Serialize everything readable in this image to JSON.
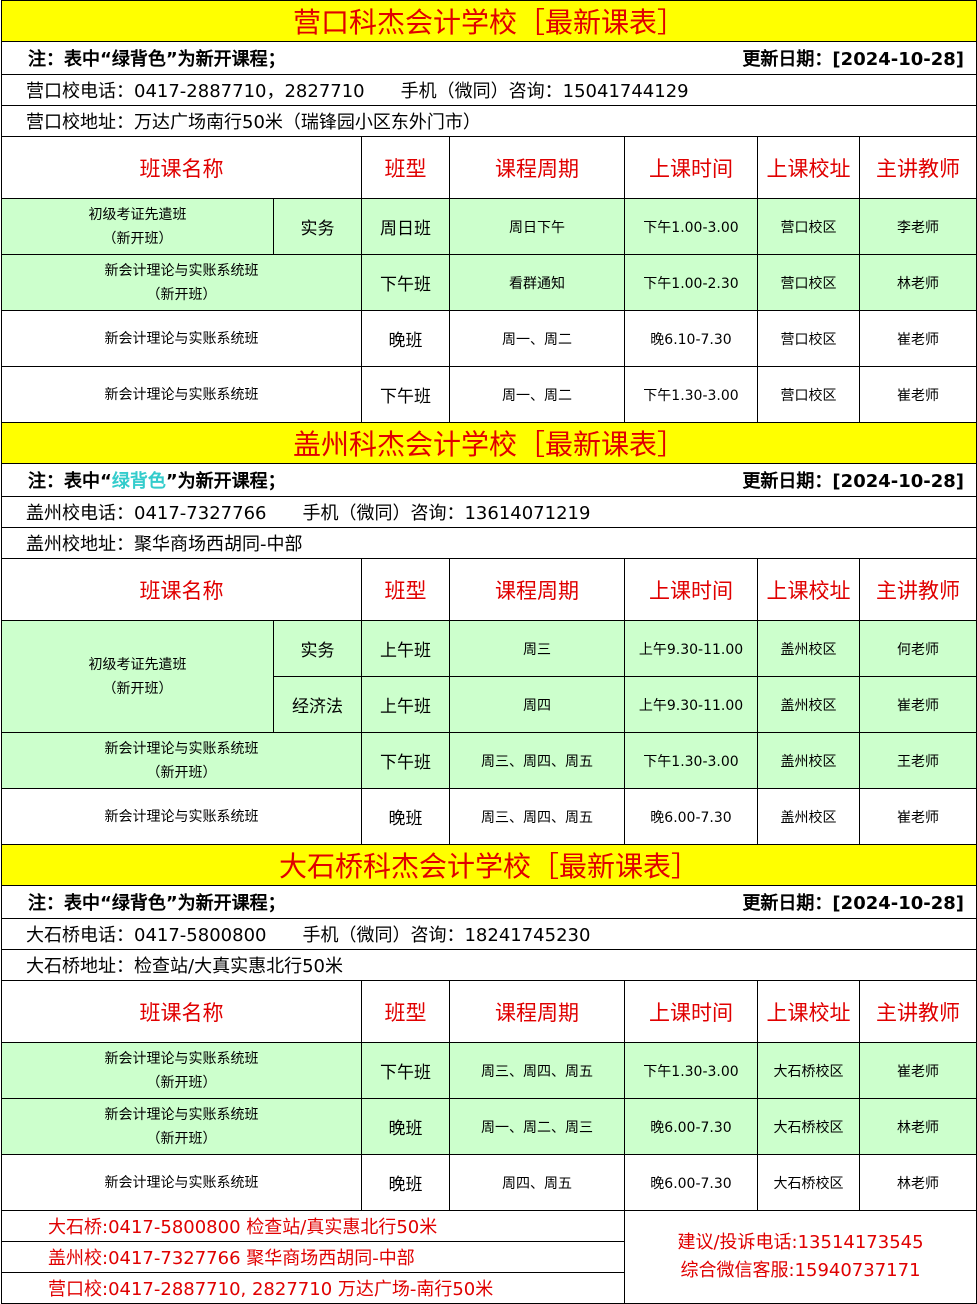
{
  "common": {
    "note_prefix": "注：表中“",
    "note_green": "绿背色",
    "note_suffix": "”为新开课程；",
    "update": "更新日期：[2024-10-28]",
    "headers": [
      "班课名称",
      "班型",
      "课程周期",
      "上课时间",
      "上课校址",
      "主讲教师"
    ]
  },
  "yingkou": {
    "title": "营口科杰会计学校［最新课表］",
    "phone": "营口校电话：0417-2887710，2827710　　手机（微同）咨询：15041744129",
    "address": "营口校地址：万达广场南行50米（瑞锋园小区东外门市）",
    "rows": [
      {
        "name1": "初级考证先遣班",
        "name2": "（新开班）",
        "sub": "实务",
        "type": "周日班",
        "period": "周日下午",
        "time": "下午1.00-3.00",
        "campus": "营口校区",
        "teacher": "李老师"
      },
      {
        "name1": "新会计理论与实账系统班",
        "name2": "（新开班）",
        "type": "下午班",
        "period": "看群通知",
        "time": "下午1.00-2.30",
        "campus": "营口校区",
        "teacher": "林老师"
      },
      {
        "name1": "新会计理论与实账系统班",
        "type": "晚班",
        "period": "周一、周二",
        "time": "晚6.10-7.30",
        "campus": "营口校区",
        "teacher": "崔老师"
      },
      {
        "name1": "新会计理论与实账系统班",
        "type": "下午班",
        "period": "周一、周二",
        "time": "下午1.30-3.00",
        "campus": "营口校区",
        "teacher": "崔老师"
      }
    ]
  },
  "gaizhou": {
    "title": "盖州科杰会计学校［最新课表］",
    "phone": "盖州校电话：0417-7327766　　手机（微同）咨询：13614071219",
    "address": "盖州校地址：聚华商场西胡同-中部",
    "rows": [
      {
        "name1": "初级考证先遣班",
        "name2": "（新开班）",
        "sub": "实务",
        "type": "上午班",
        "period": "周三",
        "time": "上午9.30-11.00",
        "campus": "盖州校区",
        "teacher": "何老师"
      },
      {
        "sub": "经济法",
        "type": "上午班",
        "period": "周四",
        "time": "上午9.30-11.00",
        "campus": "盖州校区",
        "teacher": "崔老师"
      },
      {
        "name1": "新会计理论与实账系统班",
        "name2": "（新开班）",
        "type": "下午班",
        "period": "周三、周四、周五",
        "time": "下午1.30-3.00",
        "campus": "盖州校区",
        "teacher": "王老师"
      },
      {
        "name1": "新会计理论与实账系统班",
        "type": "晚班",
        "period": "周三、周四、周五",
        "time": "晚6.00-7.30",
        "campus": "盖州校区",
        "teacher": "崔老师"
      }
    ]
  },
  "dashiqiao": {
    "title": "大石桥科杰会计学校［最新课表］",
    "phone": "大石桥电话：0417-5800800　　手机（微同）咨询：18241745230",
    "address": "大石桥地址：检查站/大真实惠北行50米",
    "rows": [
      {
        "name1": "新会计理论与实账系统班",
        "name2": "（新开班）",
        "type": "下午班",
        "period": "周三、周四、周五",
        "time": "下午1.30-3.00",
        "campus": "大石桥校区",
        "teacher": "崔老师"
      },
      {
        "name1": "新会计理论与实账系统班",
        "name2": "（新开班）",
        "type": "晚班",
        "period": "周一、周二、周三",
        "time": "晚6.00-7.30",
        "campus": "大石桥校区",
        "teacher": "林老师"
      },
      {
        "name1": "新会计理论与实账系统班",
        "type": "晚班",
        "period": "周四、周五",
        "time": "晚6.00-7.30",
        "campus": "大石桥校区",
        "teacher": "林老师"
      }
    ]
  },
  "footer": {
    "line1": "大石桥:0417-5800800 检查站/真实惠北行50米",
    "line2": "盖州校:0417-7327766 聚华商场西胡同-中部",
    "line3": "营口校:0417-2887710, 2827710 万达广场-南行50米",
    "complaint": "建议/投诉电话:13514173545",
    "wechat": "综合微信客服:15940737171"
  },
  "colors": {
    "title_bg": "#ffff00",
    "title_text": "#e00000",
    "new_course_bg": "#ccffcc",
    "note_green": "#33cccc"
  }
}
